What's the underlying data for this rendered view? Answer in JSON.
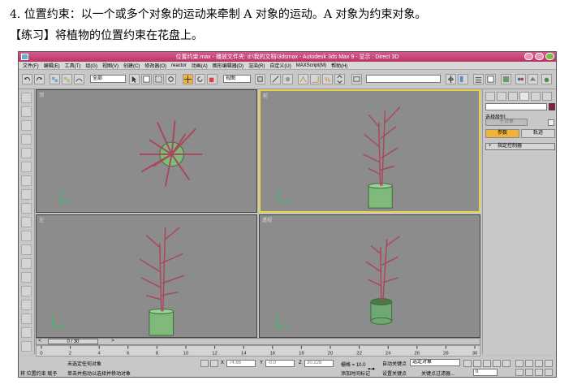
{
  "doc": {
    "line1": "4.   位置约束：以一个或多个对象的运动来牵制 A 对象的运动。A 对象为约束对象。",
    "line2": "【练习】将植物的位置约束在花盘上。"
  },
  "window": {
    "title": "位置约束.max  - 播放文件夹: d:\\我的文档\\3dsmax  - Autodesk 3ds Max 9  - 显示 : Direct 3D"
  },
  "menu": [
    "文件(F)",
    "编辑(E)",
    "工具(T)",
    "组(G)",
    "视图(V)",
    "创建(C)",
    "修改器(O)",
    "reactor",
    "动画(A)",
    "图形编辑器(D)",
    "渲染(R)",
    "自定义(U)",
    "MAXScript(M)",
    "帮助(H)"
  ],
  "toolbar": {
    "filter_value": "全部",
    "coord_value": "视图"
  },
  "viewports": {
    "top_label": "顶",
    "front_label": "前",
    "left_label": "左",
    "persp_label": "透视"
  },
  "command_panel": {
    "selection_label": "选择级别:",
    "selection_value": "子对象",
    "params_tab": "参数",
    "tracks_tab": "轨迹",
    "rollout": "指定控制器",
    "rollout_plus": "+"
  },
  "timeline": {
    "slider_label": "0 / 30",
    "prev_arrow": "<",
    "next_arrow": ">",
    "ticks": [
      "0",
      "2",
      "4",
      "6",
      "8",
      "10",
      "12",
      "14",
      "16",
      "18",
      "20",
      "22",
      "24",
      "26",
      "28",
      "30"
    ]
  },
  "status": {
    "selected_text": "未选定任何对象",
    "prompt_text": "单击并拖动以选择并移动对象",
    "macro_label": "将 位置约束 赋予",
    "x_label": "X",
    "x_value": "74.66",
    "y_label": "Y",
    "y_value": "-0.0",
    "z_label": "Z",
    "z_value": "30.228",
    "grid_text": "栅格 = 10.0",
    "add_time_tag": "添加时间标记",
    "auto_key": "自动关键点",
    "set_key": "设置关键点",
    "selected_object": "选定对象",
    "key_filters": "关键点过滤器...",
    "frame_value": "0"
  },
  "colors": {
    "title_bar": "#c74675",
    "viewport_bg": "#8c8c8c",
    "active_border": "#e6d34f",
    "plant_leaf": "#a8485c",
    "pot": "#6fa872",
    "highlight": "#f0b23a"
  }
}
